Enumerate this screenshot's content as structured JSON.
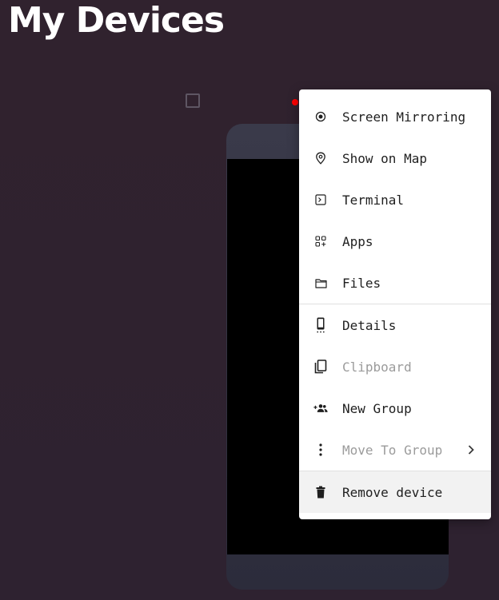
{
  "page": {
    "title": "My Devices"
  },
  "device": {
    "status_color": "#ff0000"
  },
  "context_menu": {
    "items": [
      {
        "label": "Screen Mirroring",
        "icon": "screen-mirroring-icon",
        "disabled": false
      },
      {
        "label": "Show on Map",
        "icon": "map-pin-icon",
        "disabled": false
      },
      {
        "label": "Terminal",
        "icon": "terminal-icon",
        "disabled": false
      },
      {
        "label": "Apps",
        "icon": "apps-icon",
        "disabled": false
      },
      {
        "label": "Files",
        "icon": "folder-icon",
        "disabled": false
      },
      {
        "label": "Details",
        "icon": "phone-details-icon",
        "disabled": false
      },
      {
        "label": "Clipboard",
        "icon": "clipboard-icon",
        "disabled": true
      },
      {
        "label": "New Group",
        "icon": "add-group-icon",
        "disabled": false
      },
      {
        "label": "Move To Group",
        "icon": "more-vert-icon",
        "disabled": true
      },
      {
        "label": "Remove device",
        "icon": "trash-icon",
        "disabled": false
      }
    ]
  }
}
